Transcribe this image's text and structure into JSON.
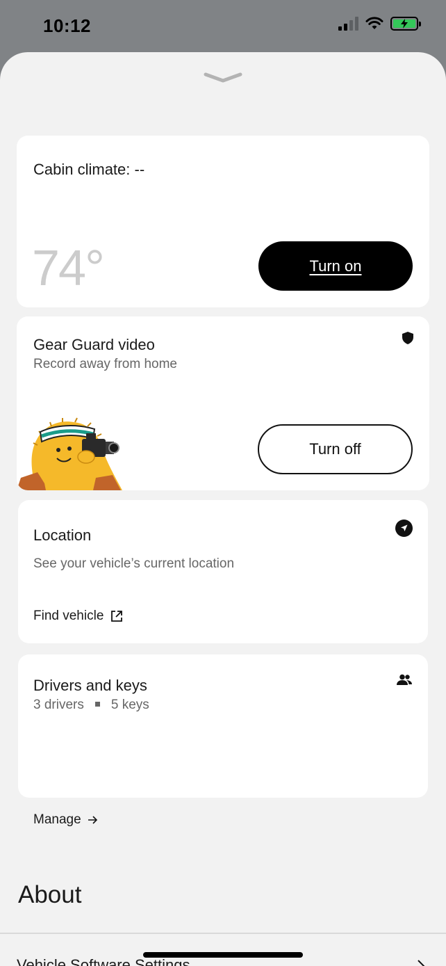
{
  "status_bar": {
    "time": "10:12"
  },
  "climate": {
    "title": "Cabin climate: --",
    "temperature": "74°",
    "button_label": "Turn on"
  },
  "gear_guard": {
    "title": "Gear Guard video",
    "subtitle": "Record away from home",
    "button_label": "Turn off",
    "icon": "shield-icon"
  },
  "location": {
    "title": "Location",
    "subtitle": "See your vehicle’s current location",
    "link_label": "Find vehicle",
    "icon": "navigation-arrow-icon"
  },
  "drivers": {
    "title": "Drivers and keys",
    "drivers_count": "3 drivers",
    "keys_count": "5 keys",
    "link_label": "Manage",
    "icon": "people-icon"
  },
  "about": {
    "title": "About",
    "next_row_label": "Vehicle Software Settings"
  },
  "colors": {
    "sheet_bg": "#f2f2f2",
    "card_bg": "#ffffff",
    "primary_button": "#000000",
    "battery_green": "#34c759"
  }
}
